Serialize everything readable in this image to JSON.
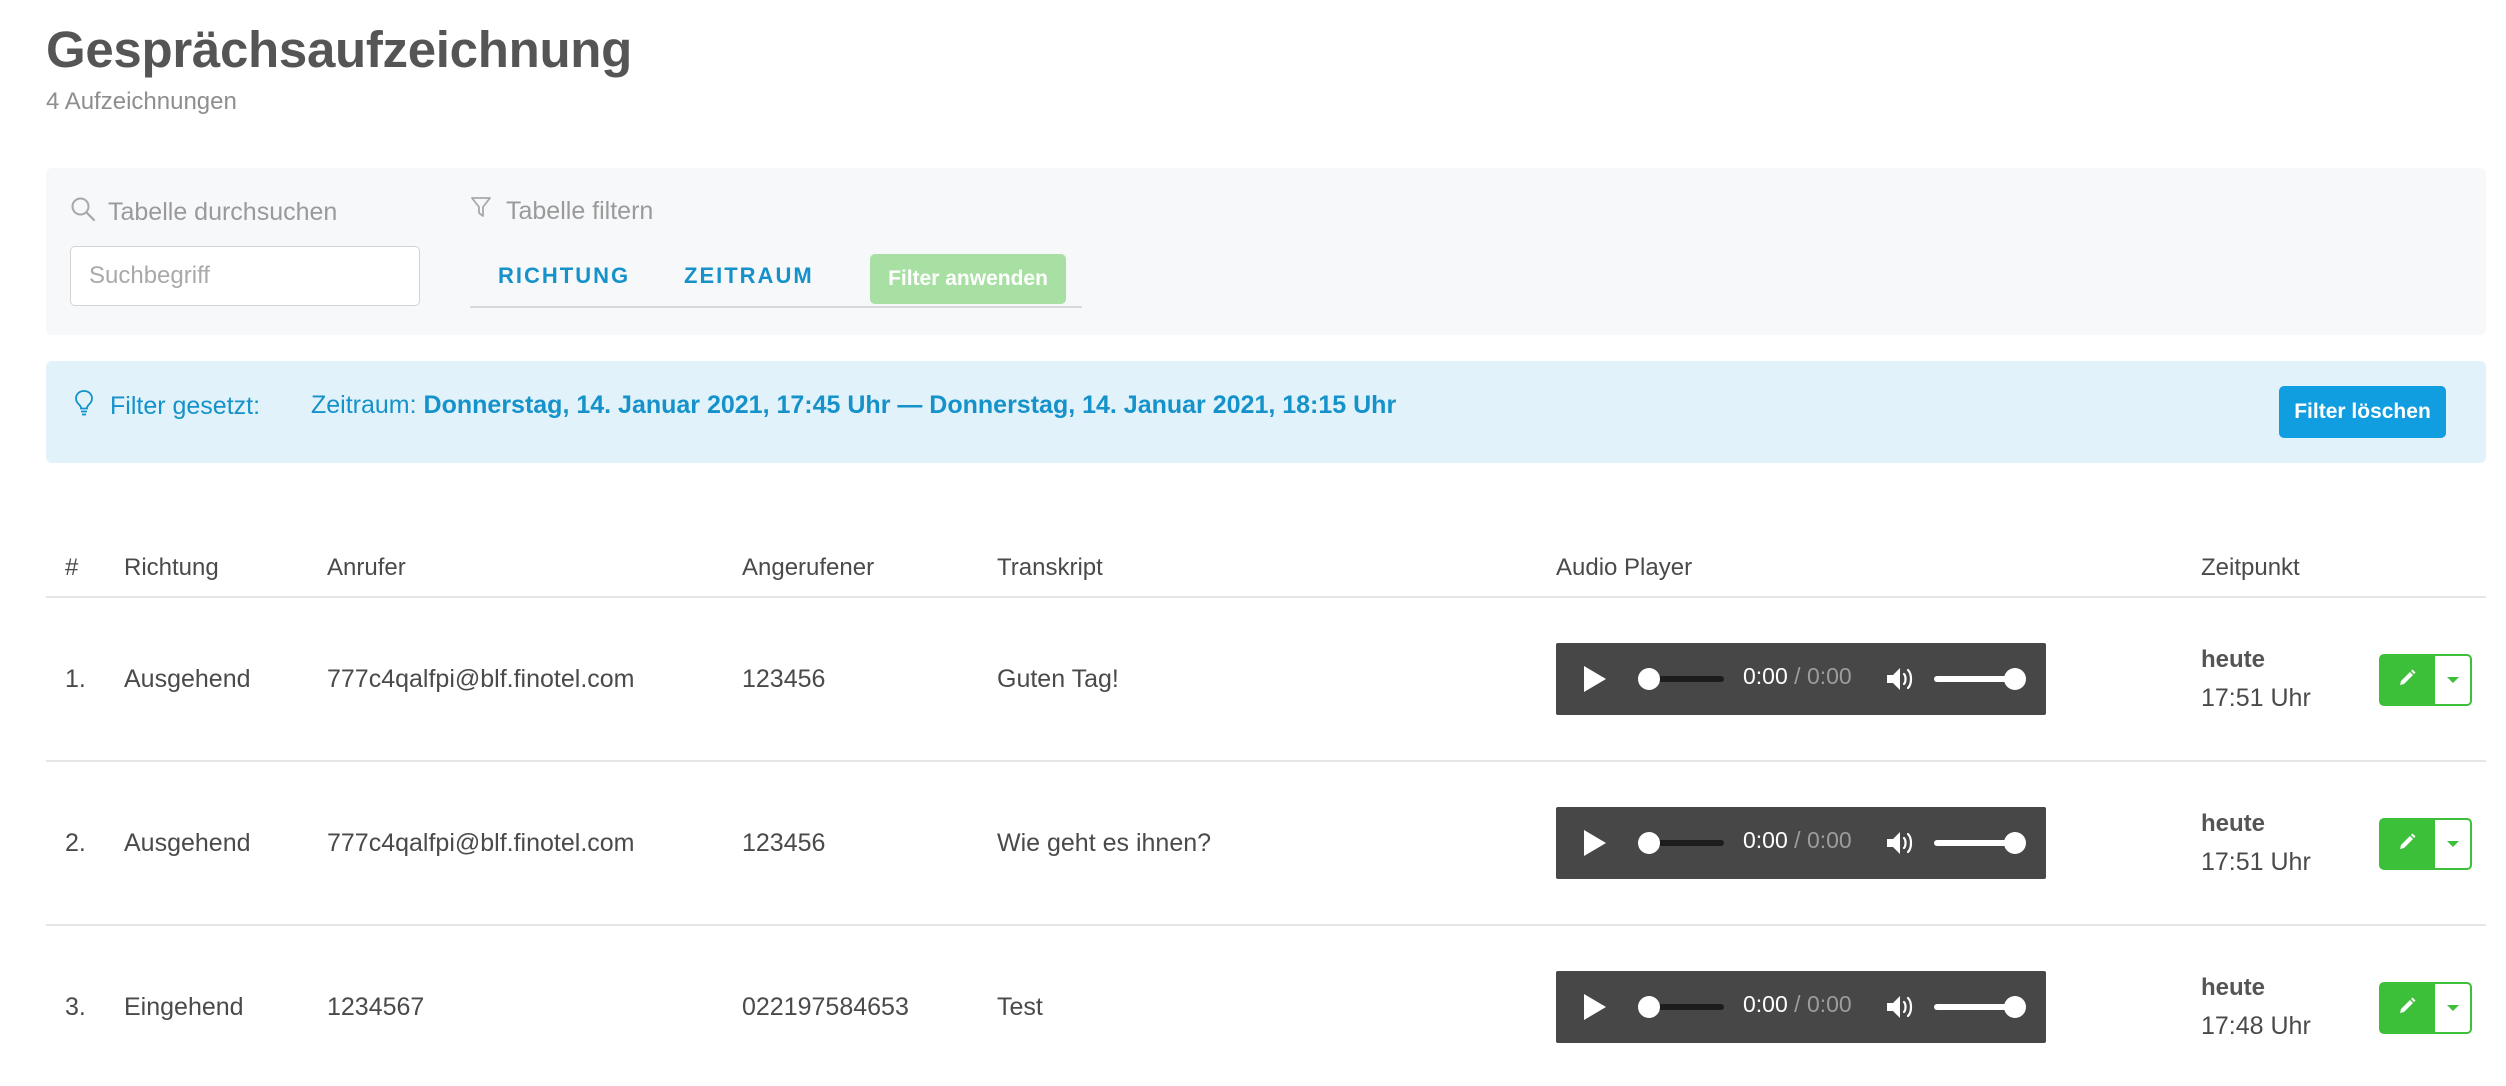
{
  "page": {
    "title": "Gesprächsaufzeichnung",
    "subtitle": "4 Aufzeichnungen"
  },
  "search": {
    "label": "Tabelle durchsuchen",
    "placeholder": "Suchbegriff",
    "value": ""
  },
  "filter": {
    "label": "Tabelle filtern",
    "tabs": [
      "RICHTUNG",
      "ZEITRAUM"
    ],
    "apply_label": "Filter anwenden"
  },
  "banner": {
    "label": "Filter gesetzt:",
    "field": "Zeitraum:",
    "value": "Donnerstag, 14. Januar 2021, 17:45 Uhr — Donnerstag, 14. Januar 2021, 18:15 Uhr",
    "clear_label": "Filter löschen"
  },
  "table": {
    "headers": {
      "num": "#",
      "direction": "Richtung",
      "caller": "Anrufer",
      "callee": "Angerufener",
      "transcript": "Transkript",
      "audio": "Audio Player",
      "time": "Zeitpunkt"
    },
    "rows": [
      {
        "num": "1.",
        "direction": "Ausgehend",
        "caller": "777c4qalfpi@blf.finotel.com",
        "callee": "123456",
        "transcript": "Guten Tag!",
        "current": "0:00",
        "duration": "0:00",
        "day": "heute",
        "clock": "17:51 Uhr"
      },
      {
        "num": "2.",
        "direction": "Ausgehend",
        "caller": "777c4qalfpi@blf.finotel.com",
        "callee": "123456",
        "transcript": "Wie geht es ihnen?",
        "current": "0:00",
        "duration": "0:00",
        "day": "heute",
        "clock": "17:51 Uhr"
      },
      {
        "num": "3.",
        "direction": "Eingehend",
        "caller": "1234567",
        "callee": "022197584653",
        "transcript": "Test",
        "current": "0:00",
        "duration": "0:00",
        "day": "heute",
        "clock": "17:48 Uhr"
      }
    ]
  },
  "player": {
    "separator": "/",
    "volume": 1.0,
    "progress": 0.0
  },
  "icons": {
    "search": "search-icon",
    "filter": "funnel-icon",
    "info": "lightbulb-icon",
    "play": "play-icon",
    "volume": "volume-icon",
    "edit": "pencil-icon",
    "caret": "caret-down-icon"
  },
  "colors": {
    "accent": "#1592c9",
    "primary_button": "#119ee0",
    "success": "#3cbf39",
    "success_disabled": "#a8e0a3",
    "banner_bg": "#e1f2fa",
    "panel_bg": "#f7f8fa",
    "player_bg": "#474747"
  }
}
